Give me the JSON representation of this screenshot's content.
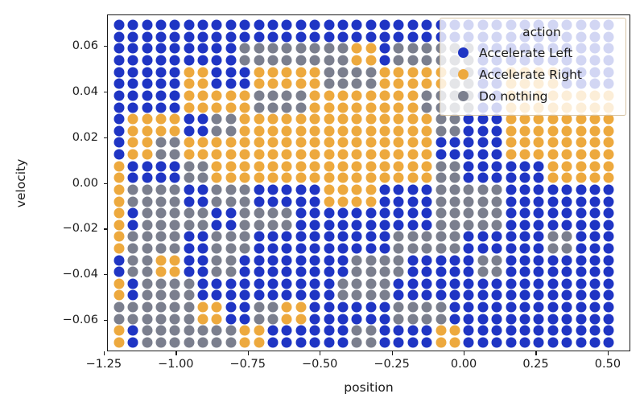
{
  "chart_data": {
    "type": "scatter",
    "title": "",
    "xlabel": "position",
    "ylabel": "velocity",
    "xlim": [
      -1.2385,
      0.5785
    ],
    "ylim": [
      -0.0738,
      0.0738
    ],
    "xticks": [
      -1.25,
      -1.0,
      -0.75,
      -0.5,
      -0.25,
      0.0,
      0.25,
      0.5
    ],
    "xticklabels": [
      "−1.25",
      "−1.00",
      "−0.75",
      "−0.50",
      "−0.25",
      "0.00",
      "0.25",
      "0.50"
    ],
    "yticks": [
      0.06,
      0.04,
      0.02,
      0.0,
      -0.02,
      -0.04,
      -0.06
    ],
    "yticklabels": [
      "0.06",
      "0.04",
      "0.02",
      "0.00",
      "−0.02",
      "−0.04",
      "−0.06"
    ],
    "grid": false,
    "legend_position": "upper right",
    "legend_title": "action",
    "marker_size_px": 13,
    "grid_cols": 36,
    "grid_rows": 28,
    "x_start": -1.2,
    "x_step": 0.0486,
    "y_start": 0.0695,
    "y_step": -0.00515,
    "categories": [
      {
        "key": "0",
        "label": "Accelerate Left",
        "color": "#1f35c4"
      },
      {
        "key": "1",
        "label": "Accelerate Right",
        "color": "#eda93e"
      },
      {
        "key": "2",
        "label": "Do nothing",
        "color": "#7b7f8e"
      }
    ],
    "policy_rows": [
      "000000000000000000000000000000000000",
      "000000000000000000000000000000000000",
      "000000000222222221102222220000000000",
      "000000000222222221102222220000000000",
      "000001100011111222211111220011110000",
      "000001100011111222211111220011110000",
      "000001111122221111111122220011111111",
      "000001111122221111111122220011111111",
      "011110022111111111111112200011111111",
      "011110022111111111111112200011111111",
      "011221111111111111111110000011111111",
      "011221111111111111111110000011111111",
      "100002211111111111111112200000011111",
      "100002211111111111111112200000011111",
      "122220022200000111100002222200000000",
      "122220022200000111100002222200000000",
      "102222200222200000000002222200000000",
      "102222200222200000000002222200000000",
      "122220022200000000002222200000022000",
      "122220022200000000002222200000022000",
      "022110022000000002222000002200000000",
      "022110022000000002222000002200000000",
      "102222000000000022220000000000000000",
      "102222000000000022220000000000000000",
      "222222110022110000002222000000000000",
      "222222110022110000002222000000000000",
      "102222222110000002200001100000000000",
      "102222222110000002200001100000000000"
    ]
  }
}
